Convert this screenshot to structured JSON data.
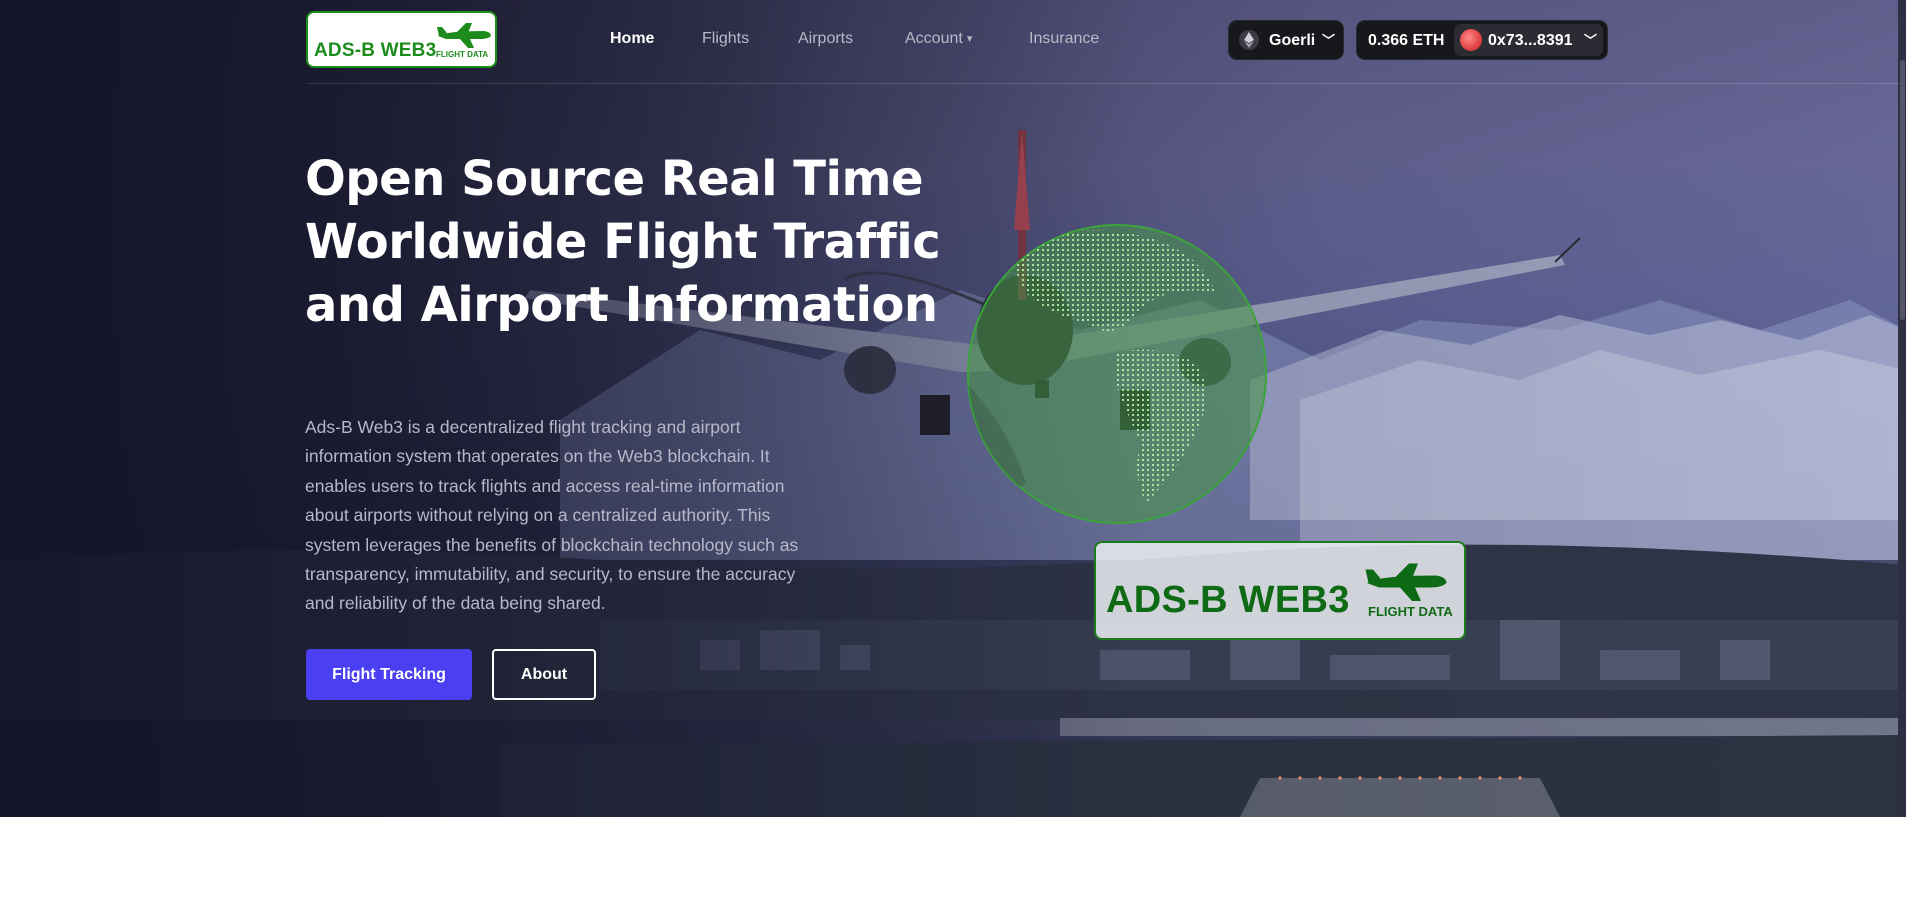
{
  "logo": {
    "title": "ADS-B WEB3",
    "subtitle": "FLIGHT DATA"
  },
  "nav": {
    "items": [
      {
        "label": "Home",
        "active": true
      },
      {
        "label": "Flights"
      },
      {
        "label": "Airports"
      },
      {
        "label": "Account",
        "has_dropdown": true
      },
      {
        "label": "Insurance"
      }
    ]
  },
  "wallet": {
    "network": "Goerli",
    "network_icon": "ethereum-icon",
    "balance": "0.366 ETH",
    "address": "0x73...8391"
  },
  "hero": {
    "headline": "Open Source Real Time Worldwide Flight Traffic and Airport Information",
    "description": "Ads-B Web3 is a decentralized flight tracking and airport information system that operates on the Web3 blockchain. It enables users to track flights and access real-time information about airports without relying on a centralized authority. This system leverages the benefits of blockchain technology such as transparency, immutability, and security, to ensure the accuracy and reliability of the data being shared.",
    "primary_button": "Flight Tracking",
    "secondary_button": "About"
  },
  "card": {
    "title": "ADS-B WEB3",
    "subtitle": "FLIGHT DATA"
  },
  "colors": {
    "brand_green": "#1d8c1d",
    "primary_button": "#4a3ff1",
    "hero_overlay": "#1b1b2e"
  }
}
